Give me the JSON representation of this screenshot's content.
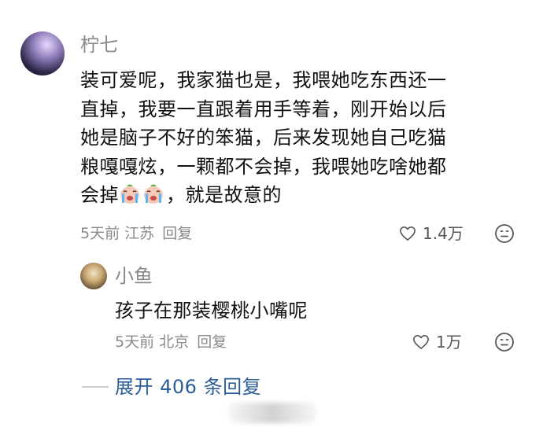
{
  "comment": {
    "username": "柠七",
    "text_lines": [
      "装可爱呢，我家猫也是，我喂她吃东西还一",
      "直掉，我要一直跟着用手等着，刚开始以后",
      "她是脑子不好的笨猫，后来发现她自己吃猫",
      "粮嘎嘎炫，一颗都不会掉，我喂她吃啥她都"
    ],
    "last_line_prefix": "会掉",
    "last_line_suffix": "，就是故意的",
    "emojis": [
      "crying-face-emoji",
      "crying-face-emoji"
    ],
    "time": "5天前",
    "location": "江苏",
    "reply_label": "回复",
    "likes": "1.4万"
  },
  "reply": {
    "username": "小鱼",
    "text": "孩子在那装樱桃小嘴呢",
    "time": "5天前",
    "location": "北京",
    "reply_label": "回复",
    "likes": "1万"
  },
  "expand": {
    "label": "展开 406 条回复"
  },
  "colors": {
    "username": "#8a8a8a",
    "meta": "#8a8a8a",
    "link": "#2a5d9a",
    "text": "#111111"
  }
}
